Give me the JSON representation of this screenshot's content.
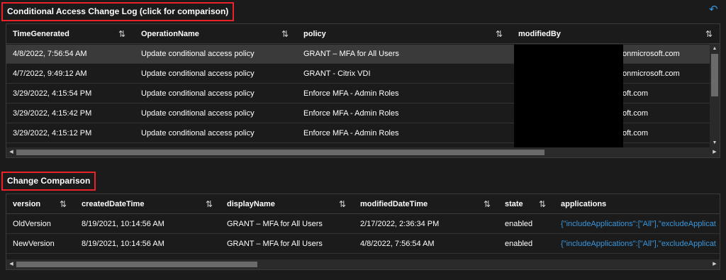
{
  "log": {
    "title": "Conditional Access Change Log (click for comparison)",
    "columns": [
      "TimeGenerated",
      "OperationName",
      "policy",
      "modifiedBy"
    ],
    "sort_icon": "⇅",
    "rows": [
      [
        "4/8/2022, 7:56:54 AM",
        "Update conditional access policy",
        "GRANT – MFA for All Users",
        "onmicrosoft.com"
      ],
      [
        "4/7/2022, 9:49:12 AM",
        "Update conditional access policy",
        "GRANT - Citrix VDI",
        "onmicrosoft.com"
      ],
      [
        "3/29/2022, 4:15:54 PM",
        "Update conditional access policy",
        "Enforce MFA - Admin Roles",
        "oft.com"
      ],
      [
        "3/29/2022, 4:15:42 PM",
        "Update conditional access policy",
        "Enforce MFA - Admin Roles",
        "oft.com"
      ],
      [
        "3/29/2022, 4:15:12 PM",
        "Update conditional access policy",
        "Enforce MFA - Admin Roles",
        "oft.com"
      ]
    ]
  },
  "comparison": {
    "title": "Change Comparison",
    "columns": [
      "version",
      "createdDateTime",
      "displayName",
      "modifiedDateTime",
      "state",
      "applications"
    ],
    "rows": [
      [
        "OldVersion",
        "8/19/2021, 10:14:56 AM",
        "GRANT – MFA for All Users",
        "2/17/2022, 2:36:34 PM",
        "enabled",
        "{\"includeApplications\":[\"All\"],\"excludeApplicat"
      ],
      [
        "NewVersion",
        "8/19/2021, 10:14:56 AM",
        "GRANT – MFA for All Users",
        "4/8/2022, 7:56:54 AM",
        "enabled",
        "{\"includeApplications\":[\"All\"],\"excludeApplicat"
      ]
    ]
  },
  "icons": {
    "undo": "undo-icon",
    "arrow_up": "▲",
    "arrow_down": "▼",
    "arrow_left": "◀",
    "arrow_right": "▶"
  },
  "colors": {
    "background": "#1b1b1b",
    "highlight_border": "#e8232a",
    "link": "#3a96dd",
    "selected_row": "#3a3a3a"
  }
}
